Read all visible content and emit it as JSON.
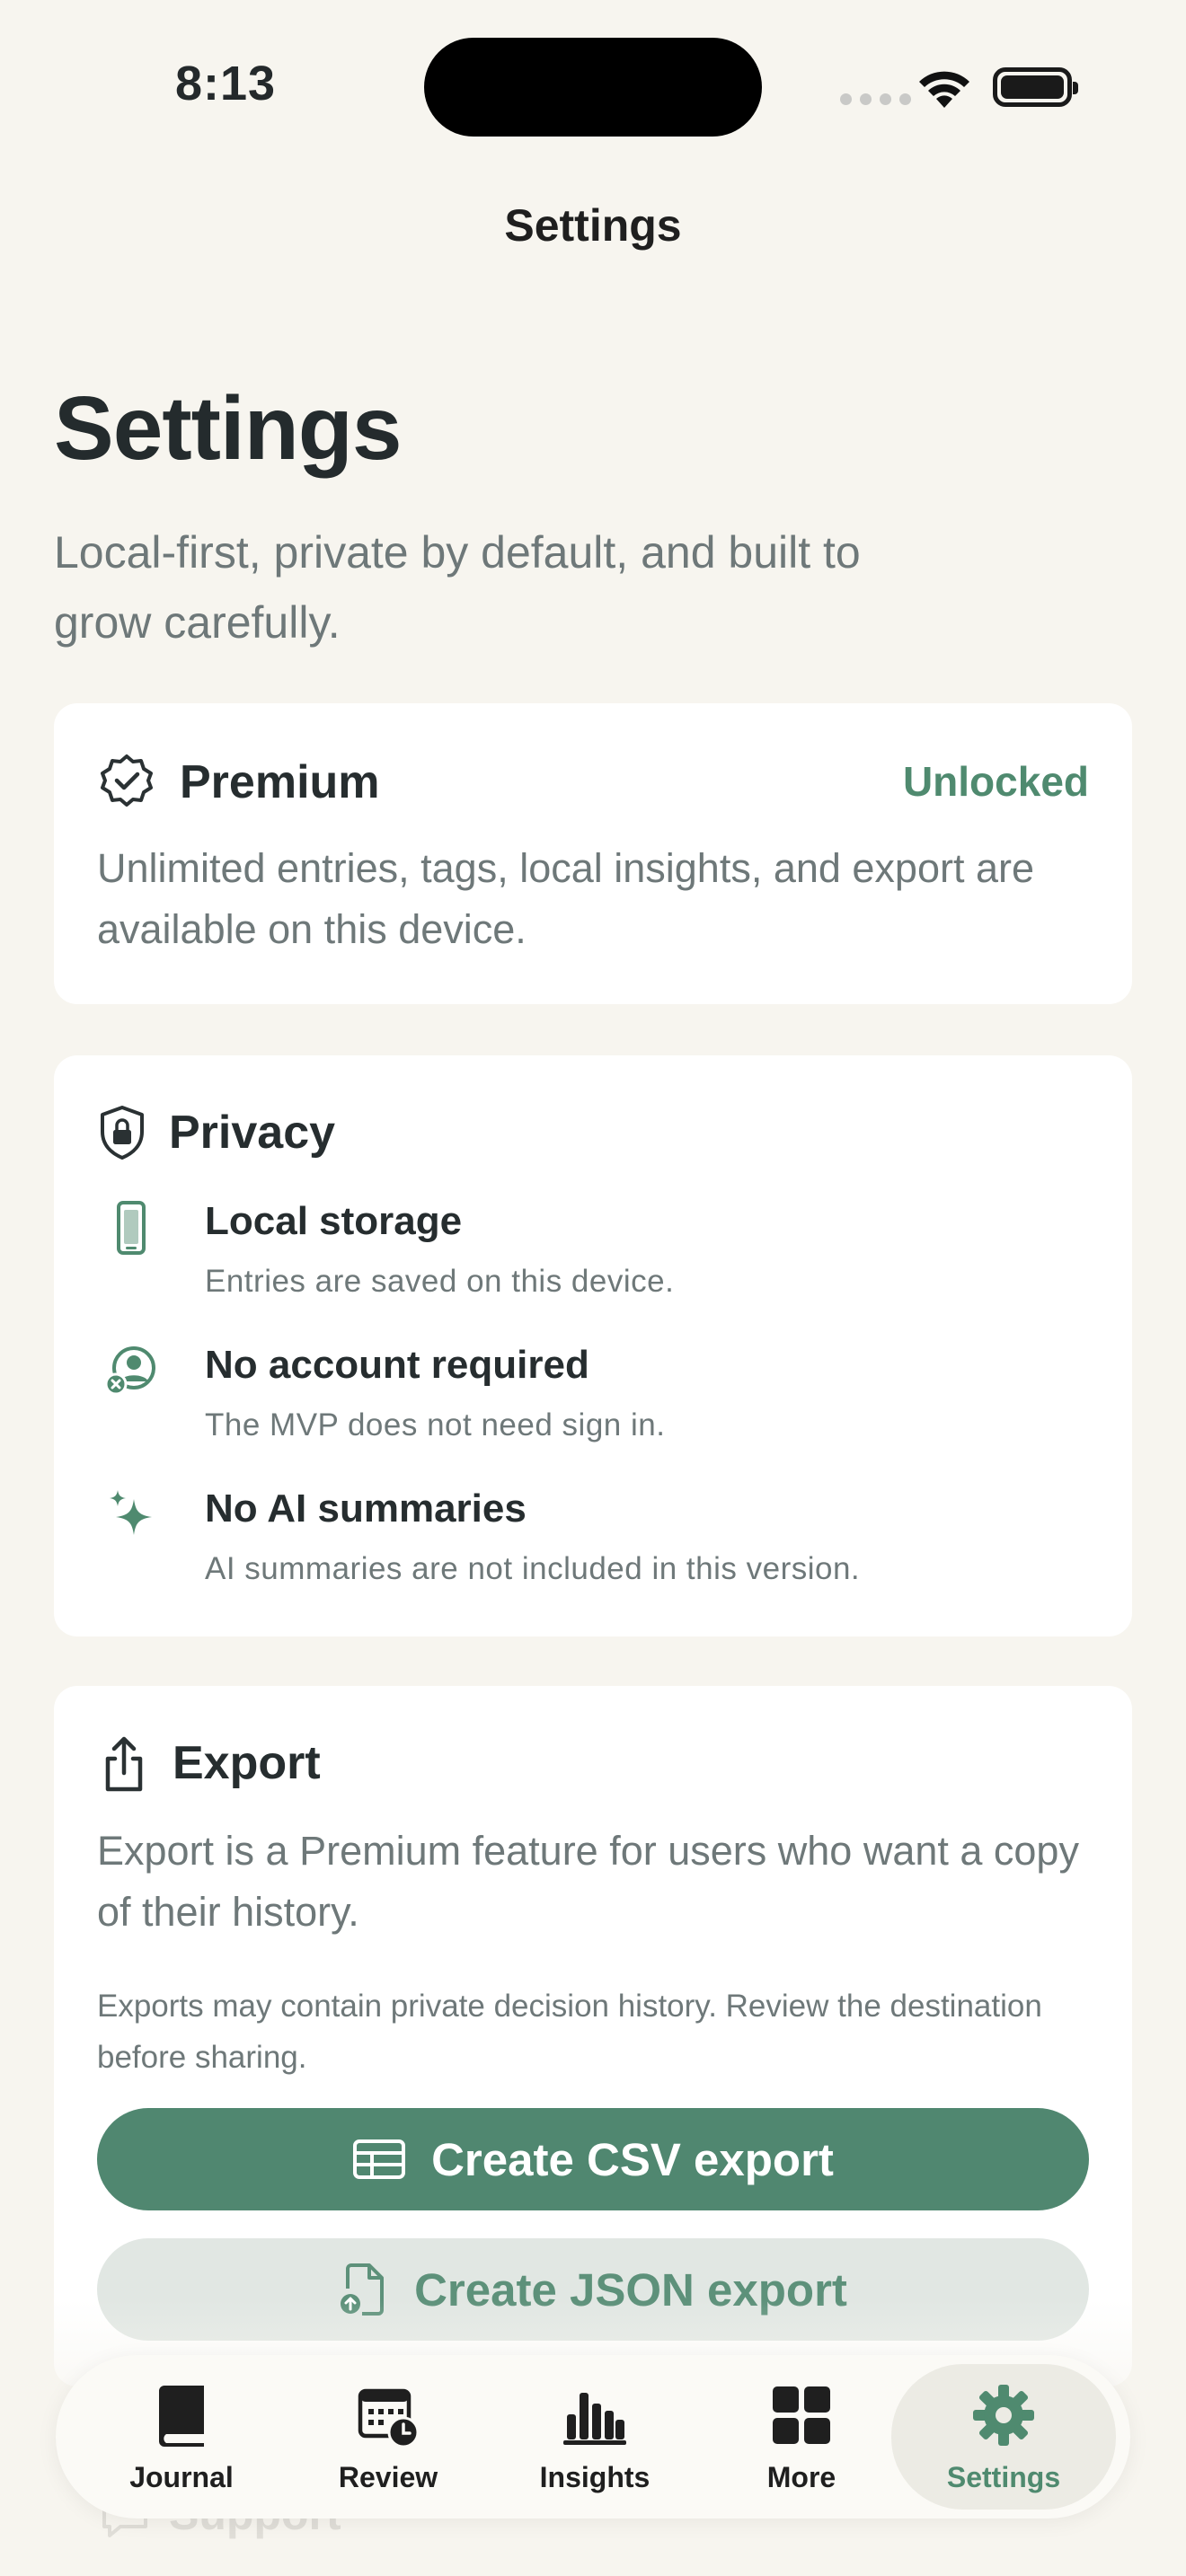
{
  "status_bar": {
    "time": "8:13"
  },
  "nav": {
    "title": "Settings"
  },
  "header": {
    "title": "Settings",
    "subtitle": "Local-first, private by default, and built to grow carefully."
  },
  "premium": {
    "title": "Premium",
    "status": "Unlocked",
    "body": "Unlimited entries, tags, local insights, and export are available on this device.",
    "accent_color": "#4f8a6f"
  },
  "privacy": {
    "title": "Privacy",
    "items": [
      {
        "icon": "phone-icon",
        "title": "Local storage",
        "desc": "Entries are saved on this device."
      },
      {
        "icon": "no-account-icon",
        "title": "No account required",
        "desc": "The MVP does not need sign in."
      },
      {
        "icon": "sparkles-icon",
        "title": "No AI summaries",
        "desc": "AI summaries are not included in this version."
      }
    ]
  },
  "export": {
    "title": "Export",
    "body": "Export is a Premium feature for users who want a copy of their history.",
    "note": "Exports may contain private decision history. Review the destination before sharing.",
    "csv_label": "Create CSV export",
    "json_label": "Create JSON export",
    "primary_color": "#508770"
  },
  "support": {
    "label": "Support"
  },
  "tabs": [
    {
      "label": "Journal",
      "icon": "book-icon"
    },
    {
      "label": "Review",
      "icon": "calendar-clock-icon"
    },
    {
      "label": "Insights",
      "icon": "bar-chart-icon"
    },
    {
      "label": "More",
      "icon": "grid-icon"
    },
    {
      "label": "Settings",
      "icon": "gear-icon",
      "active": true
    }
  ]
}
